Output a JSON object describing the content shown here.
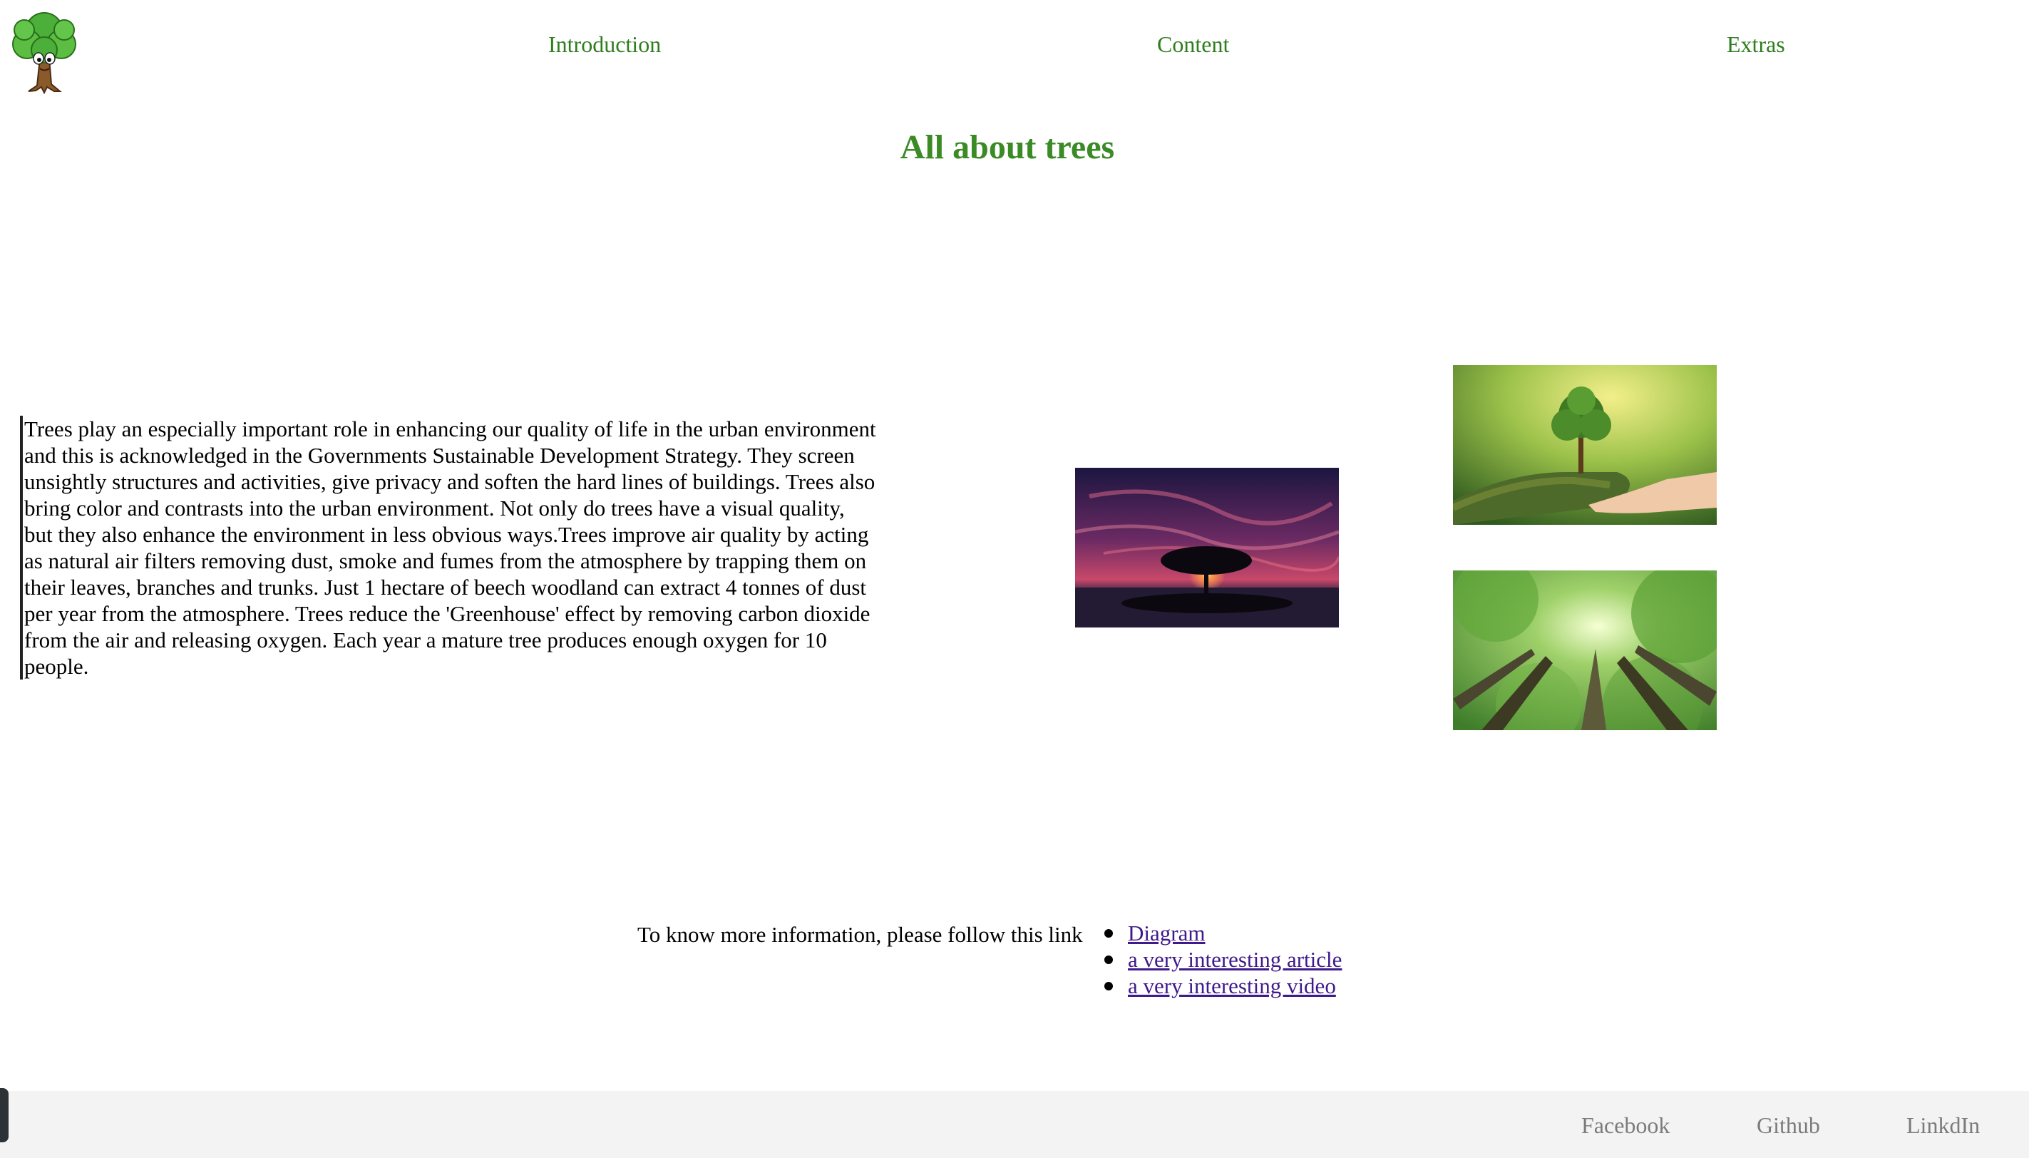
{
  "nav": {
    "items": [
      "Introduction",
      "Content",
      "Extras"
    ]
  },
  "main": {
    "title": "All about trees",
    "paragraph": "Trees play an especially important role in enhancing our quality of life in the urban environment and this is acknowledged in the Governments Sustainable Development Strategy. They screen unsightly structures and activities, give privacy and soften the hard lines of buildings. Trees also bring color and contrasts into the urban environment. Not only do trees have a visual quality, but they also enhance the environment in less obvious ways.Trees improve air quality by acting as natural air filters removing dust, smoke and fumes from the atmosphere by trapping them on their leaves, branches and trunks. Just 1 hectare of beech woodland can extract 4 tonnes of dust per year from the atmosphere. Trees reduce the 'Greenhouse' effect by removing carbon dioxide from the air and releasing oxygen. Each year a mature tree produces enough oxygen for 10 people."
  },
  "more_info": {
    "text": "To know more information, please follow this link",
    "links": [
      "Diagram",
      "a very interesting article",
      "a very interesting video"
    ]
  },
  "footer": {
    "links": [
      "Facebook",
      "Github",
      "LinkdIn"
    ]
  },
  "colors": {
    "nav_link": "#2f7d1e",
    "title": "#3a8a25",
    "link_visited": "#3e1a8c",
    "footer_bg": "#f3f3f3",
    "footer_link": "#7b7b7b"
  },
  "icons": [
    "tree-cartoon-logo"
  ]
}
